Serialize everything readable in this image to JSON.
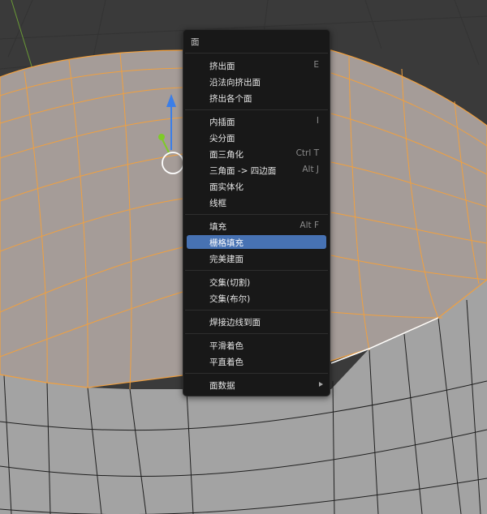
{
  "menu": {
    "title": "面",
    "groups": [
      [
        {
          "label": "挤出面",
          "shortcut": "E"
        },
        {
          "label": "沿法向挤出面",
          "shortcut": ""
        },
        {
          "label": "挤出各个面",
          "shortcut": ""
        }
      ],
      [
        {
          "label": "内插面",
          "shortcut": "I"
        },
        {
          "label": "尖分面",
          "shortcut": ""
        },
        {
          "label": "面三角化",
          "shortcut": "Ctrl T"
        },
        {
          "label": "三角面 -> 四边面",
          "shortcut": "Alt J"
        },
        {
          "label": "面实体化",
          "shortcut": ""
        },
        {
          "label": "线框",
          "shortcut": ""
        }
      ],
      [
        {
          "label": "填充",
          "shortcut": "Alt F"
        },
        {
          "label": "栅格填充",
          "shortcut": "",
          "highlighted": true
        },
        {
          "label": "完美建面",
          "shortcut": ""
        }
      ],
      [
        {
          "label": "交集(切割)",
          "shortcut": ""
        },
        {
          "label": "交集(布尔)",
          "shortcut": ""
        }
      ],
      [
        {
          "label": "焊接边线到面",
          "shortcut": ""
        }
      ],
      [
        {
          "label": "平滑着色",
          "shortcut": ""
        },
        {
          "label": "平直着色",
          "shortcut": ""
        }
      ],
      [
        {
          "label": "面数据",
          "shortcut": "",
          "submenu": true
        }
      ]
    ]
  },
  "colors": {
    "background": "#3a3a3a",
    "selected_face": "#a59c98",
    "selected_edge": "#f0a040",
    "side_face": "#a3a3a3",
    "menu_bg": "#181818",
    "highlight": "#4772b3",
    "gizmo_z": "#3b7ee8",
    "gizmo_y": "#7ecb27"
  }
}
